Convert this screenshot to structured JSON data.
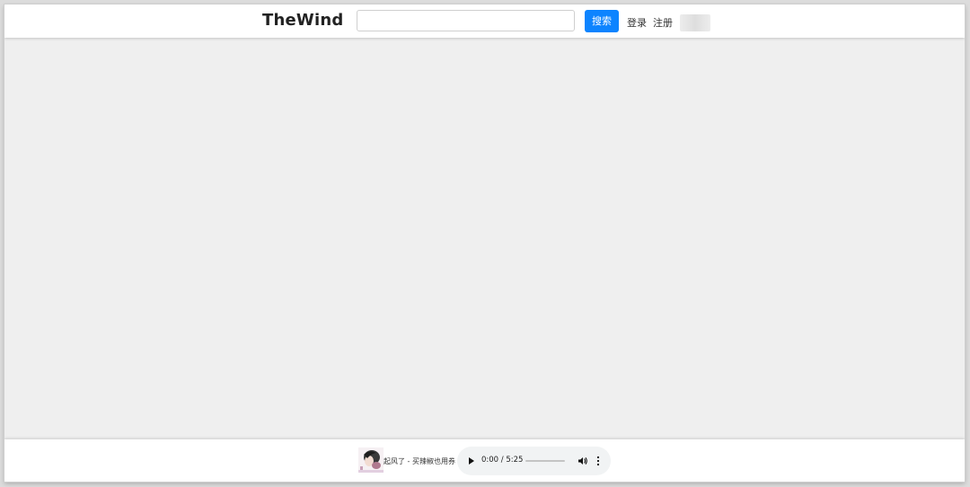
{
  "header": {
    "logo": "TheWind",
    "search": {
      "value": "",
      "placeholder": ""
    },
    "search_button_label": "搜索",
    "login_label": "登录",
    "register_label": "注册"
  },
  "player": {
    "song_title": "起风了 - 买辣椒也用券",
    "current_time": "0:00",
    "duration": "5:25",
    "time_display": "0:00 / 5:25",
    "progress_fraction": 0,
    "album_art_icon": "album-cover-image",
    "play_icon": "play-icon",
    "volume_icon": "volume-icon",
    "more_icon": "more-vertical-icon"
  },
  "colors": {
    "accent": "#0d84ff",
    "background": "#efefef",
    "header_bg": "#ffffff",
    "player_control_bg": "#f1f3f4"
  }
}
